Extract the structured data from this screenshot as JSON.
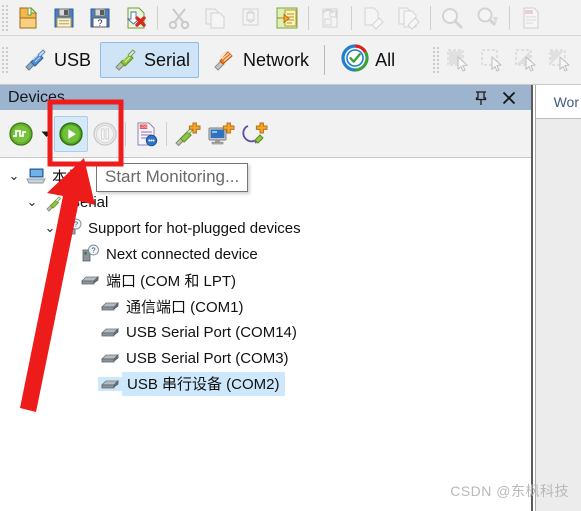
{
  "toolbars": {
    "main": {
      "name": "file-toolbar",
      "buttons": [
        {
          "name": "new-file-button",
          "icon": "new-document-icon",
          "label": "New",
          "enabled": true
        },
        {
          "name": "save-button",
          "icon": "save-floppy-icon",
          "label": "Save",
          "enabled": true
        },
        {
          "name": "save-as-button",
          "icon": "save-as-floppy-question-icon",
          "label": "Save As",
          "enabled": true
        },
        {
          "name": "close-file-button",
          "icon": "close-document-red-x-icon",
          "label": "Close",
          "enabled": true
        },
        {
          "name": "cut-button",
          "icon": "scissors-icon",
          "label": "Cut",
          "enabled": false
        },
        {
          "name": "copy-button",
          "icon": "copy-documents-icon",
          "label": "Copy",
          "enabled": false
        },
        {
          "name": "paste-button",
          "icon": "paste-box-icon",
          "label": "Paste",
          "enabled": false
        },
        {
          "name": "export-button",
          "icon": "export-yellow-arrow-document-icon",
          "label": "Export",
          "enabled": true
        },
        {
          "name": "import-button",
          "icon": "import-arrow-icon",
          "label": "Import",
          "enabled": false
        },
        {
          "name": "clear-button",
          "icon": "eraser-document-icon",
          "label": "Clear",
          "enabled": false
        },
        {
          "name": "clear-all-button",
          "icon": "eraser-documents-icon",
          "label": "Clear All",
          "enabled": false
        },
        {
          "name": "find-button",
          "icon": "magnifier-icon",
          "label": "Find",
          "enabled": false
        },
        {
          "name": "find-next-button",
          "icon": "magnifier-down-arrow-icon",
          "label": "Find Next",
          "enabled": false
        },
        {
          "name": "log-view-button",
          "icon": "log-document-icon",
          "label": "Log",
          "enabled": false
        }
      ]
    },
    "filter": {
      "name": "device-class-filter-toolbar",
      "items": [
        {
          "name": "filter-usb",
          "label": "USB",
          "icon": "usb-plug-blue-icon",
          "selected": false
        },
        {
          "name": "filter-serial",
          "label": "Serial",
          "icon": "serial-plug-green-icon",
          "selected": true
        },
        {
          "name": "filter-network",
          "label": "Network",
          "icon": "network-cable-orange-icon",
          "selected": false
        },
        {
          "name": "filter-all",
          "label": "All",
          "icon": "all-check-circle-icon",
          "selected": false
        }
      ],
      "selection_tools": [
        {
          "name": "select-tool-1",
          "icon": "select-filled-cursor-icon",
          "enabled": false
        },
        {
          "name": "select-tool-2",
          "icon": "select-empty-cursor-icon",
          "enabled": false
        },
        {
          "name": "select-tool-3",
          "icon": "select-half-cursor-icon",
          "enabled": false
        },
        {
          "name": "select-tool-4",
          "icon": "select-invert-cursor-icon",
          "enabled": false
        }
      ]
    }
  },
  "devices_panel": {
    "title": "Devices",
    "header_actions": [
      {
        "name": "auto-hide-pin-button",
        "icon": "pin-icon"
      },
      {
        "name": "close-panel-button",
        "icon": "close-x-icon"
      }
    ],
    "toolbar": [
      {
        "name": "capture-mode-button",
        "icon": "green-waveform-icon",
        "enabled": true
      },
      {
        "name": "capture-mode-dropdown",
        "icon": "chevron-down-icon",
        "enabled": true
      },
      {
        "name": "start-monitoring-button",
        "icon": "green-play-icon",
        "enabled": true,
        "active": true
      },
      {
        "name": "stop-monitoring-button",
        "icon": "gray-pause-icon",
        "enabled": false
      },
      {
        "name": "log-file-button",
        "icon": "log-document-globe-icon",
        "enabled": true
      },
      {
        "name": "add-serial-device-button",
        "icon": "add-serial-plug-plus-icon",
        "enabled": true
      },
      {
        "name": "add-computer-button",
        "icon": "add-monitor-plus-icon",
        "enabled": true
      },
      {
        "name": "add-remote-connection-button",
        "icon": "add-remote-connection-plus-icon",
        "enabled": true
      }
    ],
    "tooltip": "Start Monitoring...",
    "tree": [
      {
        "name": "tree-item-computer",
        "label": "本机",
        "icon": "computer-icon",
        "indent": 0,
        "twisty": "⌄",
        "selected": false
      },
      {
        "name": "tree-item-serial",
        "label": "Serial",
        "icon": "serial-plug-green-icon",
        "indent": 1,
        "twisty": "⌄",
        "selected": false
      },
      {
        "name": "tree-item-hotplug-support",
        "label": "Support for hot-plugged devices",
        "icon": "device-question-icon",
        "indent": 2,
        "twisty": "⌄",
        "selected": false
      },
      {
        "name": "tree-item-next-connected-device",
        "label": "Next connected device",
        "icon": "device-question-icon",
        "indent": 3,
        "twisty": "",
        "selected": false
      },
      {
        "name": "tree-item-ports",
        "label": "端口 (COM 和 LPT)",
        "icon": "port-icon",
        "indent": 3,
        "twisty": "",
        "selected": false
      },
      {
        "name": "tree-item-com1",
        "label": "通信端口 (COM1)",
        "icon": "port-icon",
        "indent": 4,
        "twisty": "",
        "selected": false
      },
      {
        "name": "tree-item-com14",
        "label": "USB Serial Port (COM14)",
        "icon": "port-icon",
        "indent": 4,
        "twisty": "",
        "selected": false
      },
      {
        "name": "tree-item-com3",
        "label": "USB Serial Port (COM3)",
        "icon": "port-icon",
        "indent": 4,
        "twisty": "",
        "selected": false
      },
      {
        "name": "tree-item-com2",
        "label": "USB 串行设备 (COM2)",
        "icon": "port-icon",
        "indent": 4,
        "twisty": "",
        "selected": true
      }
    ]
  },
  "right_panel": {
    "tab_label": "Wor"
  },
  "annotations": {
    "highlight_rect": {
      "name": "red-highlight-rectangle",
      "color": "#ef1c1c"
    },
    "arrow": {
      "name": "red-pointer-arrow",
      "color": "#ee1b1b"
    }
  },
  "watermark": "CSDN @东枫科技",
  "colors": {
    "panel_header": "#9cb4ce",
    "selection_blue": "#cde8fb",
    "filter_selected": "#cfe4f7",
    "annotation_red": "#ef1c1c",
    "toolbar_bg": "#f2f2f2"
  }
}
